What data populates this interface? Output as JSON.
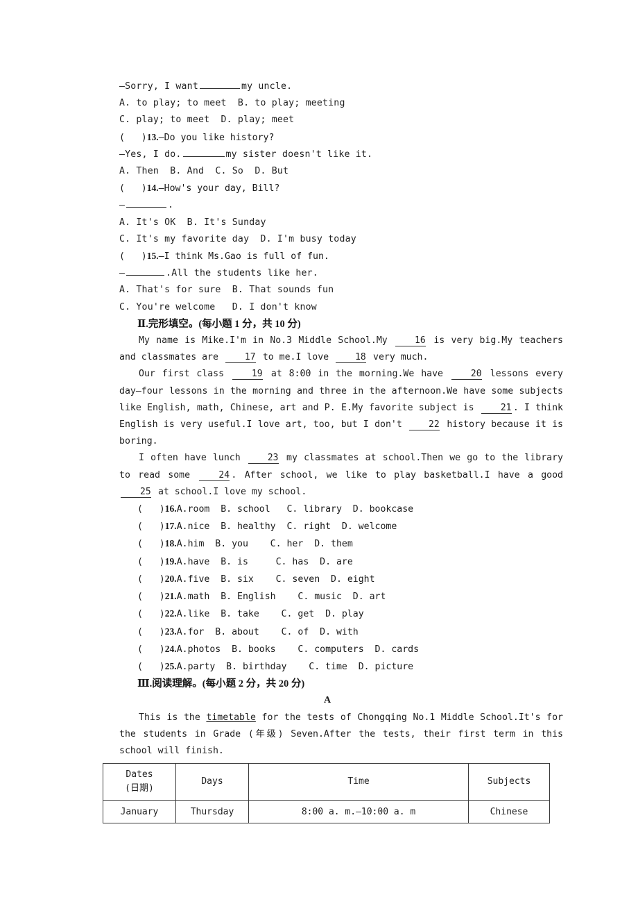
{
  "question_12_tail": {
    "stem_line": "—Sorry, I want",
    "stem_after": "my uncle.",
    "optionsAB": "A. to play; to meet  B. to play; meeting",
    "optionsCD": "C. play; to meet  D. play; meet"
  },
  "question_13": {
    "bracket": "(   )",
    "number": "13.",
    "stem": "—Do you like history?",
    "reply_before": "—Yes, I do.",
    "reply_after": "my sister doesn't like it.",
    "options": "A. Then  B. And  C. So  D. But"
  },
  "question_14": {
    "bracket": "(   )",
    "number": "14.",
    "stem": "—How's your day, Bill?",
    "reply_before": "—",
    "reply_after": ".",
    "optionsAB": "A. It's OK  B. It's Sunday",
    "optionsCD": "C. It's my favorite day  D. I'm busy today"
  },
  "question_15": {
    "bracket": "(   )",
    "number": "15.",
    "stem": "—I think Ms.Gao is full of fun.",
    "reply_before": "—",
    "reply_after": ".All the students like her.",
    "optionsAB": "A. That's for sure  B. That sounds fun",
    "optionsCD": "C. You're welcome   D. I don't know"
  },
  "section_2": {
    "numeral": "Ⅱ",
    "heading": ".完形填空。(每小题 1 分，共 10 分)",
    "passage": {
      "p1_a": "My name is Mike.I'm in No.3 Middle School.My",
      "b16": "16",
      "p1_b": "is very big.My teachers and classmates are",
      "b17": "17",
      "p1_c": "to me.I love",
      "b18": "18",
      "p1_d": "very much.",
      "p2_a": "Our first class",
      "b19": "19",
      "p2_b": "at 8:00 in the morning.We have",
      "b20": "20",
      "p2_c": "lessons every day—four lessons in the morning and three in the afternoon.We have some subjects like English, math, Chinese, art and P. E.My favorite subject is",
      "b21": "21",
      "p2_d": ". I think English is very useful.I love art, too, but I don't",
      "b22": "22",
      "p2_e": "history because it is boring.",
      "p3_a": "I often have lunch",
      "b23": "23",
      "p3_b": "my classmates at school.Then we go to the library to read some",
      "b24": "24",
      "p3_c": ". After school, we like to play basketball.I have a good",
      "b25": "25",
      "p3_d": "at school.I love my school."
    },
    "options": [
      {
        "bracket": "(   )",
        "number": "16.",
        "text": "A.room  B. school   C. library  D. bookcase"
      },
      {
        "bracket": "(   )",
        "number": "17.",
        "text": "A.nice  B. healthy  C. right  D. welcome"
      },
      {
        "bracket": "(   )",
        "number": "18.",
        "text": "A.him  B. you    C. her  D. them"
      },
      {
        "bracket": "(   )",
        "number": "19.",
        "text": "A.have  B. is     C. has  D. are"
      },
      {
        "bracket": "(   )",
        "number": "20.",
        "text": "A.five  B. six    C. seven  D. eight"
      },
      {
        "bracket": "(   )",
        "number": "21.",
        "text": "A.math  B. English    C. music  D. art"
      },
      {
        "bracket": "(   )",
        "number": "22.",
        "text": "A.like  B. take    C. get  D. play"
      },
      {
        "bracket": "(   )",
        "number": "23.",
        "text": "A.for  B. about    C. of  D. with"
      },
      {
        "bracket": "(   )",
        "number": "24.",
        "text": "A.photos  B. books    C. computers  D. cards"
      },
      {
        "bracket": "(   )",
        "number": "25.",
        "text": "A.party  B. birthday    C. time  D. picture"
      }
    ]
  },
  "section_3": {
    "numeral": "Ⅲ",
    "heading": ".阅读理解。(每小题 2 分，共 20 分)",
    "passage_label": "A",
    "reading_a": "This is the ",
    "reading_underlined": "timetable",
    "reading_b": " for the tests of Chongqing No.1 Middle School.It's for the students in Grade (年级) Seven.After the tests, their first term in this school will finish."
  },
  "timetable": {
    "headers": [
      "Dates\n(日期)",
      "Days",
      "Time",
      "Subjects"
    ],
    "header_dates_line1": "Dates",
    "header_dates_line2": "(日期)",
    "header_days": "Days",
    "header_time": "Time",
    "header_subjects": "Subjects",
    "rows": [
      {
        "dates": "January",
        "days": "Thursday",
        "time": "8:00 a. m.—10:00 a. m",
        "subjects": "Chinese"
      }
    ]
  }
}
